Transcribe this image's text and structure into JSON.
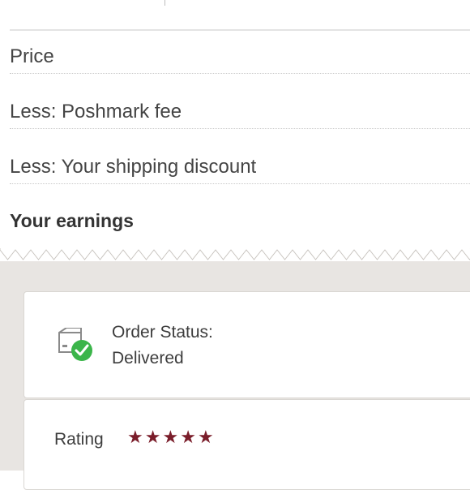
{
  "summary": {
    "price_label": "Price",
    "fee_label": "Less: Poshmark fee",
    "shipping_label": "Less: Your shipping discount",
    "earnings_label": "Your earnings"
  },
  "order": {
    "status_label": "Order Status:",
    "status_value": "Delivered",
    "icon": "delivered-box-icon"
  },
  "rating": {
    "label": "Rating",
    "stars": 5,
    "max_stars": 5,
    "star_color": "#7a1d2a"
  },
  "colors": {
    "background_grey": "#e8e5e2",
    "check_green": "#3bb54a"
  }
}
